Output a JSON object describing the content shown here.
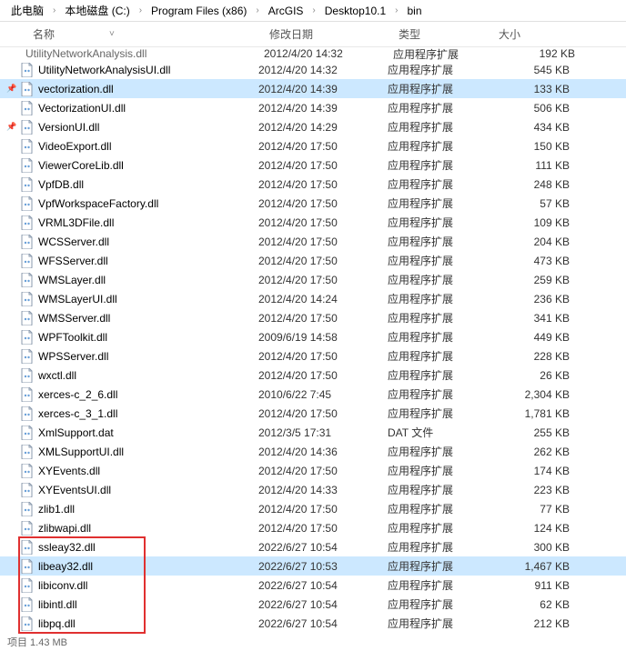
{
  "breadcrumb": [
    "此电脑",
    "本地磁盘 (C:)",
    "Program Files (x86)",
    "ArcGIS",
    "Desktop10.1",
    "bin"
  ],
  "columns": {
    "name": "名称",
    "date": "修改日期",
    "type": "类型",
    "size": "大小"
  },
  "truncated_top": {
    "name": "UtilityNetworkAnalysis.dll",
    "date": "2012/4/20 14:32",
    "type": "应用程序扩展",
    "size": "192 KB"
  },
  "files": [
    {
      "pin": false,
      "name": "UtilityNetworkAnalysisUI.dll",
      "date": "2012/4/20 14:32",
      "type": "应用程序扩展",
      "size": "545 KB",
      "selected": false
    },
    {
      "pin": true,
      "name": "vectorization.dll",
      "date": "2012/4/20 14:39",
      "type": "应用程序扩展",
      "size": "133 KB",
      "selected": true
    },
    {
      "pin": false,
      "name": "VectorizationUI.dll",
      "date": "2012/4/20 14:39",
      "type": "应用程序扩展",
      "size": "506 KB",
      "selected": false
    },
    {
      "pin": true,
      "name": "VersionUI.dll",
      "date": "2012/4/20 14:29",
      "type": "应用程序扩展",
      "size": "434 KB",
      "selected": false
    },
    {
      "pin": false,
      "name": "VideoExport.dll",
      "date": "2012/4/20 17:50",
      "type": "应用程序扩展",
      "size": "150 KB",
      "selected": false
    },
    {
      "pin": false,
      "name": "ViewerCoreLib.dll",
      "date": "2012/4/20 17:50",
      "type": "应用程序扩展",
      "size": "111 KB",
      "selected": false
    },
    {
      "pin": false,
      "name": "VpfDB.dll",
      "date": "2012/4/20 17:50",
      "type": "应用程序扩展",
      "size": "248 KB",
      "selected": false
    },
    {
      "pin": false,
      "name": "VpfWorkspaceFactory.dll",
      "date": "2012/4/20 17:50",
      "type": "应用程序扩展",
      "size": "57 KB",
      "selected": false
    },
    {
      "pin": false,
      "name": "VRML3DFile.dll",
      "date": "2012/4/20 17:50",
      "type": "应用程序扩展",
      "size": "109 KB",
      "selected": false
    },
    {
      "pin": false,
      "name": "WCSServer.dll",
      "date": "2012/4/20 17:50",
      "type": "应用程序扩展",
      "size": "204 KB",
      "selected": false
    },
    {
      "pin": false,
      "name": "WFSServer.dll",
      "date": "2012/4/20 17:50",
      "type": "应用程序扩展",
      "size": "473 KB",
      "selected": false
    },
    {
      "pin": false,
      "name": "WMSLayer.dll",
      "date": "2012/4/20 17:50",
      "type": "应用程序扩展",
      "size": "259 KB",
      "selected": false
    },
    {
      "pin": false,
      "name": "WMSLayerUI.dll",
      "date": "2012/4/20 14:24",
      "type": "应用程序扩展",
      "size": "236 KB",
      "selected": false
    },
    {
      "pin": false,
      "name": "WMSServer.dll",
      "date": "2012/4/20 17:50",
      "type": "应用程序扩展",
      "size": "341 KB",
      "selected": false
    },
    {
      "pin": false,
      "name": "WPFToolkit.dll",
      "date": "2009/6/19 14:58",
      "type": "应用程序扩展",
      "size": "449 KB",
      "selected": false
    },
    {
      "pin": false,
      "name": "WPSServer.dll",
      "date": "2012/4/20 17:50",
      "type": "应用程序扩展",
      "size": "228 KB",
      "selected": false
    },
    {
      "pin": false,
      "name": "wxctl.dll",
      "date": "2012/4/20 17:50",
      "type": "应用程序扩展",
      "size": "26 KB",
      "selected": false
    },
    {
      "pin": false,
      "name": "xerces-c_2_6.dll",
      "date": "2010/6/22 7:45",
      "type": "应用程序扩展",
      "size": "2,304 KB",
      "selected": false
    },
    {
      "pin": false,
      "name": "xerces-c_3_1.dll",
      "date": "2012/4/20 17:50",
      "type": "应用程序扩展",
      "size": "1,781 KB",
      "selected": false
    },
    {
      "pin": false,
      "name": "XmlSupport.dat",
      "date": "2012/3/5 17:31",
      "type": "DAT 文件",
      "size": "255 KB",
      "selected": false
    },
    {
      "pin": false,
      "name": "XMLSupportUI.dll",
      "date": "2012/4/20 14:36",
      "type": "应用程序扩展",
      "size": "262 KB",
      "selected": false
    },
    {
      "pin": false,
      "name": "XYEvents.dll",
      "date": "2012/4/20 17:50",
      "type": "应用程序扩展",
      "size": "174 KB",
      "selected": false
    },
    {
      "pin": false,
      "name": "XYEventsUI.dll",
      "date": "2012/4/20 14:33",
      "type": "应用程序扩展",
      "size": "223 KB",
      "selected": false
    },
    {
      "pin": false,
      "name": "zlib1.dll",
      "date": "2012/4/20 17:50",
      "type": "应用程序扩展",
      "size": "77 KB",
      "selected": false
    },
    {
      "pin": false,
      "name": "zlibwapi.dll",
      "date": "2012/4/20 17:50",
      "type": "应用程序扩展",
      "size": "124 KB",
      "selected": false
    },
    {
      "pin": false,
      "name": "ssleay32.dll",
      "date": "2022/6/27 10:54",
      "type": "应用程序扩展",
      "size": "300 KB",
      "selected": false
    },
    {
      "pin": false,
      "name": "libeay32.dll",
      "date": "2022/6/27 10:53",
      "type": "应用程序扩展",
      "size": "1,467 KB",
      "selected": true
    },
    {
      "pin": false,
      "name": "libiconv.dll",
      "date": "2022/6/27 10:54",
      "type": "应用程序扩展",
      "size": "911 KB",
      "selected": false
    },
    {
      "pin": false,
      "name": "libintl.dll",
      "date": "2022/6/27 10:54",
      "type": "应用程序扩展",
      "size": "62 KB",
      "selected": false
    },
    {
      "pin": false,
      "name": "libpq.dll",
      "date": "2022/6/27 10:54",
      "type": "应用程序扩展",
      "size": "212 KB",
      "selected": false
    }
  ],
  "highlight": {
    "start_index": 25,
    "end_index": 29
  },
  "footer": "项目   1.43 MB"
}
